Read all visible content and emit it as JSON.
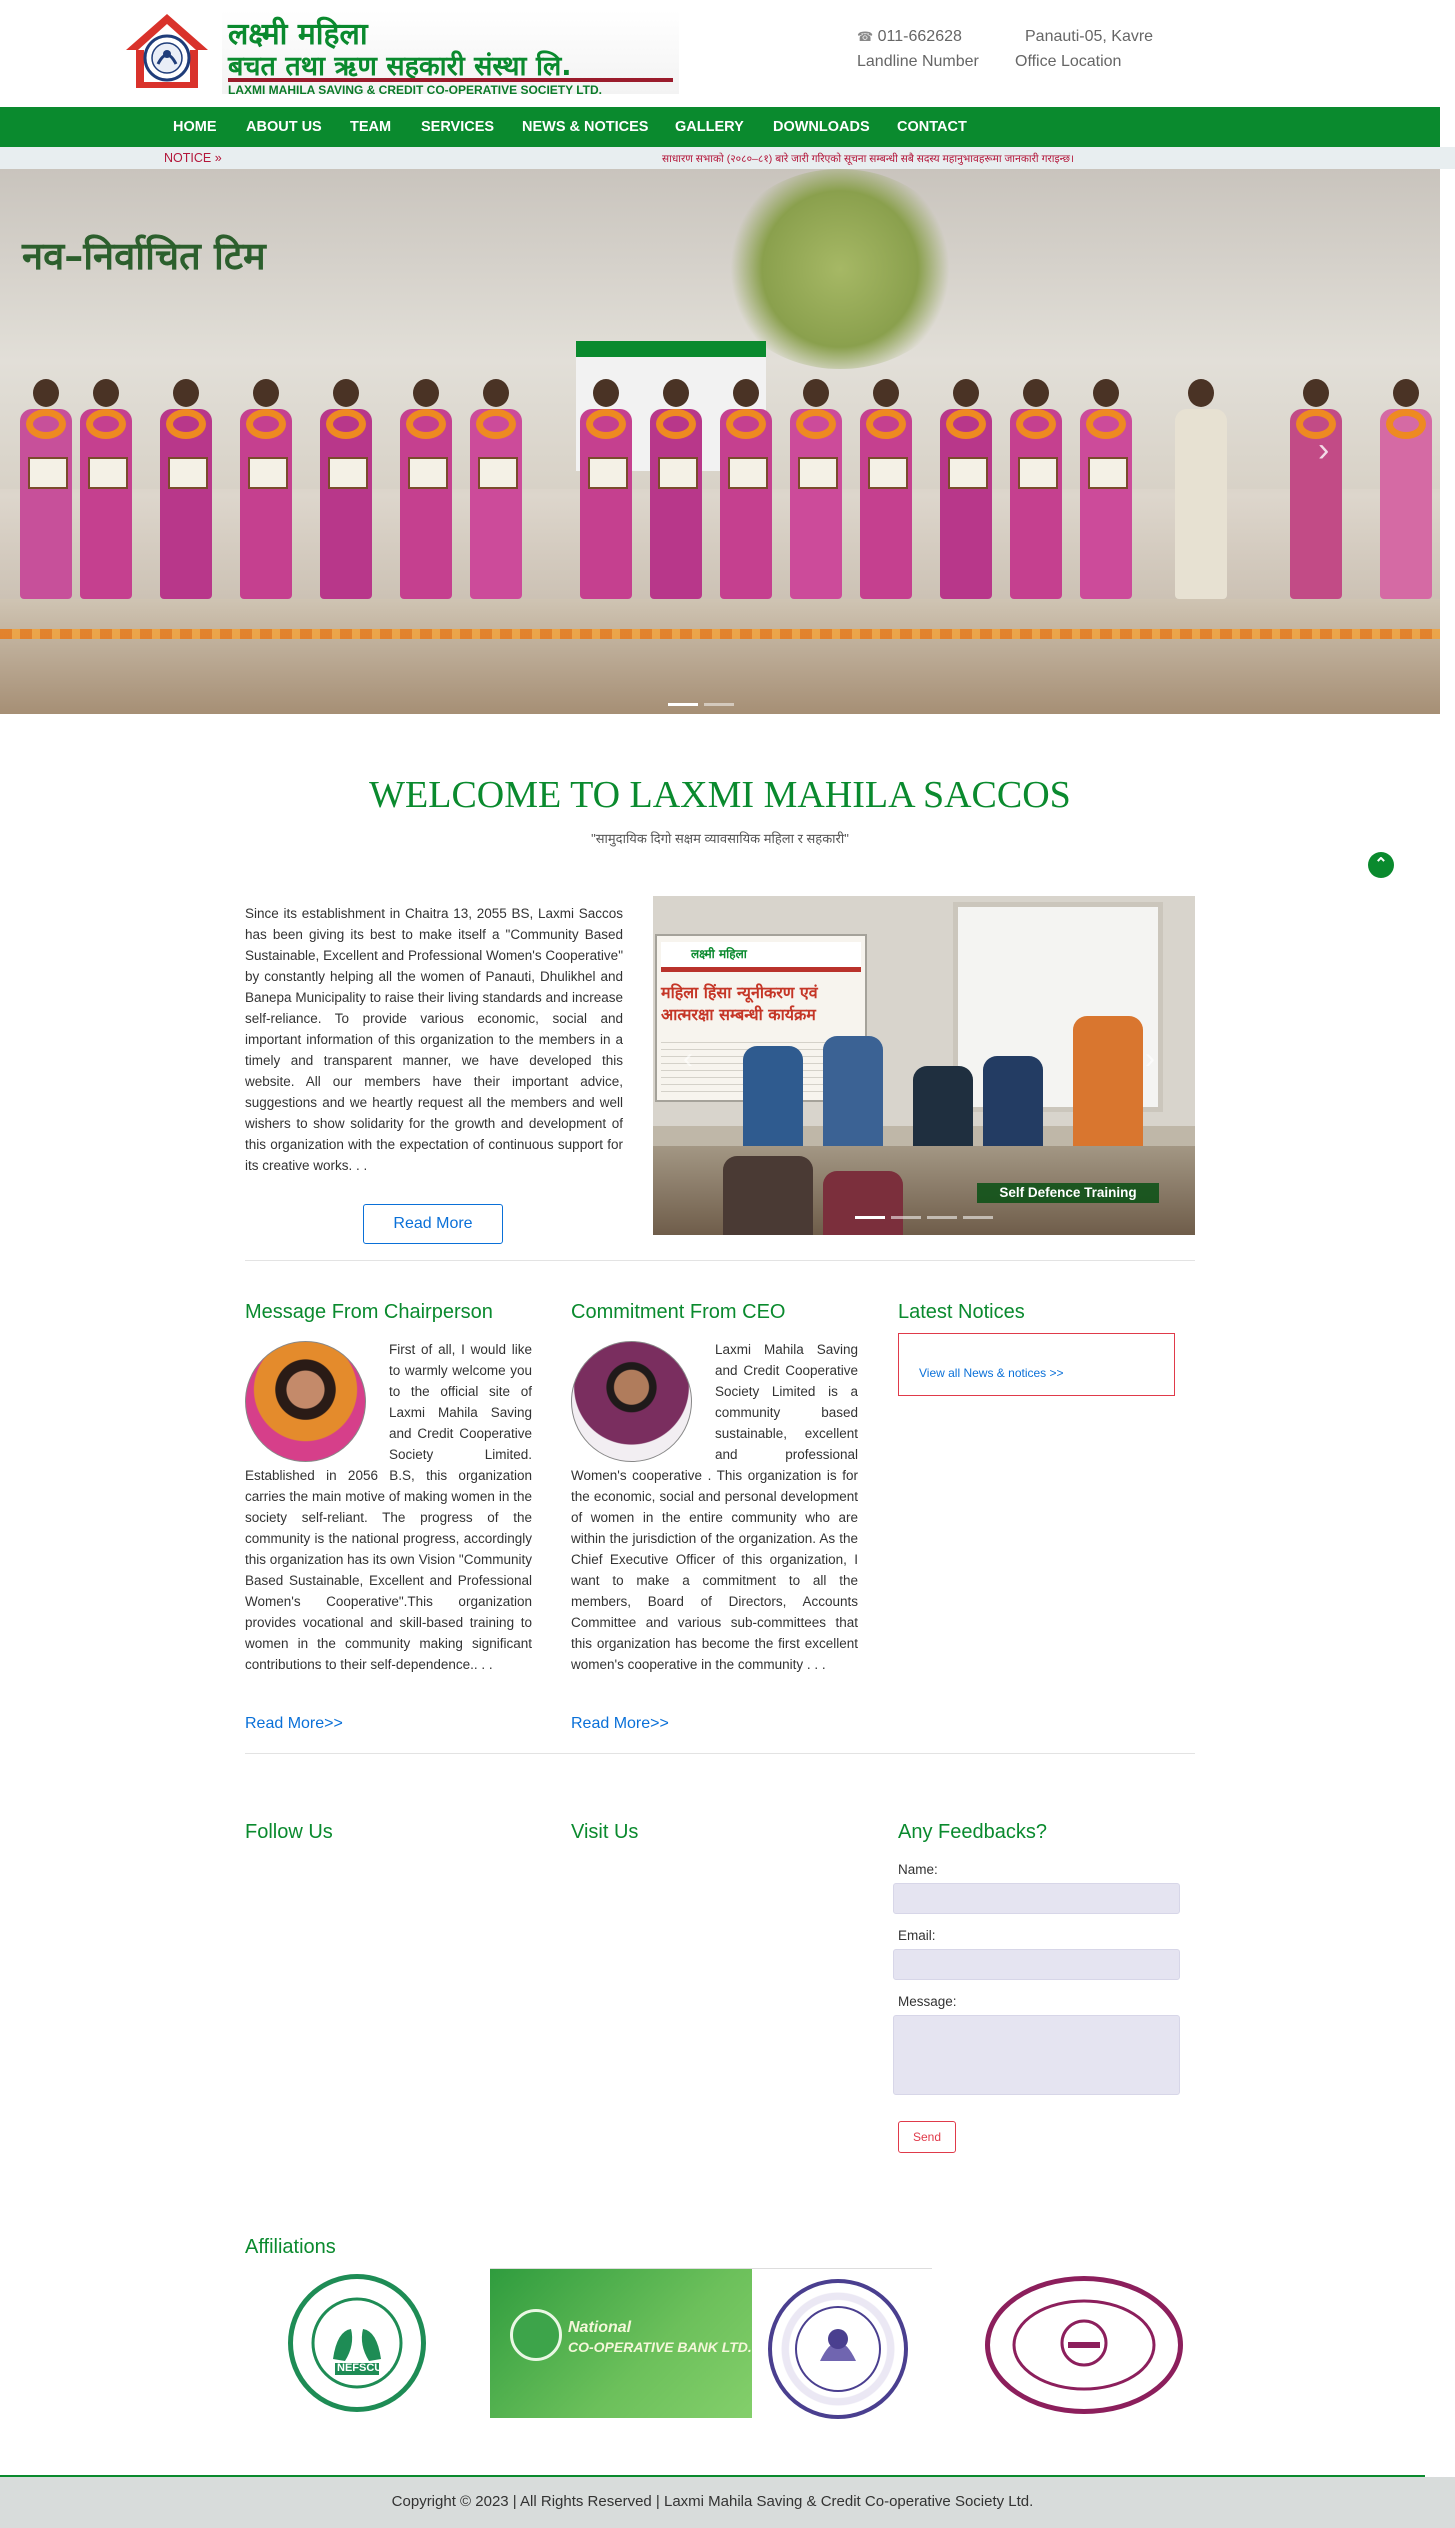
{
  "header": {
    "logo_line1": "लक्ष्मी महिला",
    "logo_line2": "बचत तथा ऋण सहकारी संस्था लि.",
    "logo_english": "LAXMI MAHILA SAVING & CREDIT CO-OPERATIVE SOCIETY LTD.",
    "phone": "011-662628",
    "phone_label": "Landline Number",
    "location": "Panauti-05, Kavre",
    "location_label": "Office Location",
    "phone_icon": "phone-icon"
  },
  "nav": {
    "items": [
      {
        "label": "HOME"
      },
      {
        "label": "ABOUT US"
      },
      {
        "label": "TEAM"
      },
      {
        "label": "SERVICES"
      },
      {
        "label": "NEWS & NOTICES"
      },
      {
        "label": "GALLERY"
      },
      {
        "label": "DOWNLOADS"
      },
      {
        "label": "CONTACT"
      }
    ]
  },
  "notice_bar": {
    "label": "NOTICE »",
    "marquee": "साधारण सभाको (२०८०–८१) बारे जारी गरिएको सूचना सम्बन्धी सबै सदस्य महानुभावहरूमा जानकारी गराइन्छ।"
  },
  "hero": {
    "title": "नव–निर्वाचित टिम",
    "next_icon": "chevron-right-icon"
  },
  "welcome": {
    "title": "WELCOME TO LAXMI MAHILA SACCOS",
    "subtitle": "\"सामुदायिक दिगो सक्षम व्यावसायिक महिला र सहकारी\"",
    "intro": "Since its establishment in Chaitra 13, 2055 BS, Laxmi Saccos has been giving its best to make itself a \"Community Based Sustainable, Excellent and Professional Women's Cooperative\" by constantly helping all the women of Panauti, Dhulikhel and Banepa Municipality to raise their living standards and increase self-reliance. To provide various economic, social and important information of this organization to the members in a timely and transparent manner, we have developed this website. All our members have their important advice, suggestions and we heartly request all the members and well wishers to show solidarity for the growth and development of this organization with the expectation of continuous support for its creative works. . .",
    "read_more": "Read More",
    "gallery_caption": "Self Defence Training",
    "gallery_banner_org": "लक्ष्मी महिला",
    "gallery_banner_title": "महिला हिंसा न्यूनीकरण एवं आत्मरक्षा सम्बन्धी कार्यक्रम"
  },
  "columns": {
    "chair_title": "Message From Chairperson",
    "chair_text": "First of all, I would like to warmly welcome you to the official site of Laxmi Mahila Saving and Credit Cooperative Society Limited. Established in 2056 B.S, this organization carries the main motive of making women in the society self-reliant. The progress of the community is the national progress, accordingly this organization has its own Vision \"Community Based Sustainable, Excellent and Professional Women's Cooperative\".This organization provides vocational and skill-based training to women in the community making significant contributions to their self-dependence.. . .",
    "chair_link": "Read More>>",
    "ceo_title": "Commitment From CEO",
    "ceo_text": "Laxmi Mahila Saving and Credit Cooperative Society Limited is a community based sustainable, excellent and professional Women's cooperative . This organization is for the economic, social and personal development of women in the entire community who are within the jurisdiction of the organization. As the Chief Executive Officer of this organization, I want to make a commitment to all the members, Board of Directors, Accounts Committee and various sub-committees that this organization has become the first excellent women's cooperative in the community . . .",
    "ceo_link": "Read More>>",
    "notices_title": "Latest Notices",
    "notices_link": "View all News & notices >>"
  },
  "lower": {
    "follow_title": "Follow Us",
    "visit_title": "Visit Us",
    "feedback_title": "Any Feedbacks?",
    "name_label": "Name:",
    "email_label": "Email:",
    "message_label": "Message:",
    "send_label": "Send"
  },
  "affiliations": {
    "title": "Affiliations",
    "nefscun_label": "NEFSCUN",
    "bank_name1": "National",
    "bank_name2": "CO-OPERATIVE BANK LTD."
  },
  "footer": {
    "text": "Copyright © 2023 | All Rights Reserved | Laxmi Mahila Saving & Credit Co-operative Society Ltd."
  },
  "colors": {
    "brand_green": "#0a8a2e",
    "notice_red": "#b3163a",
    "link_blue": "#0a70d8"
  }
}
